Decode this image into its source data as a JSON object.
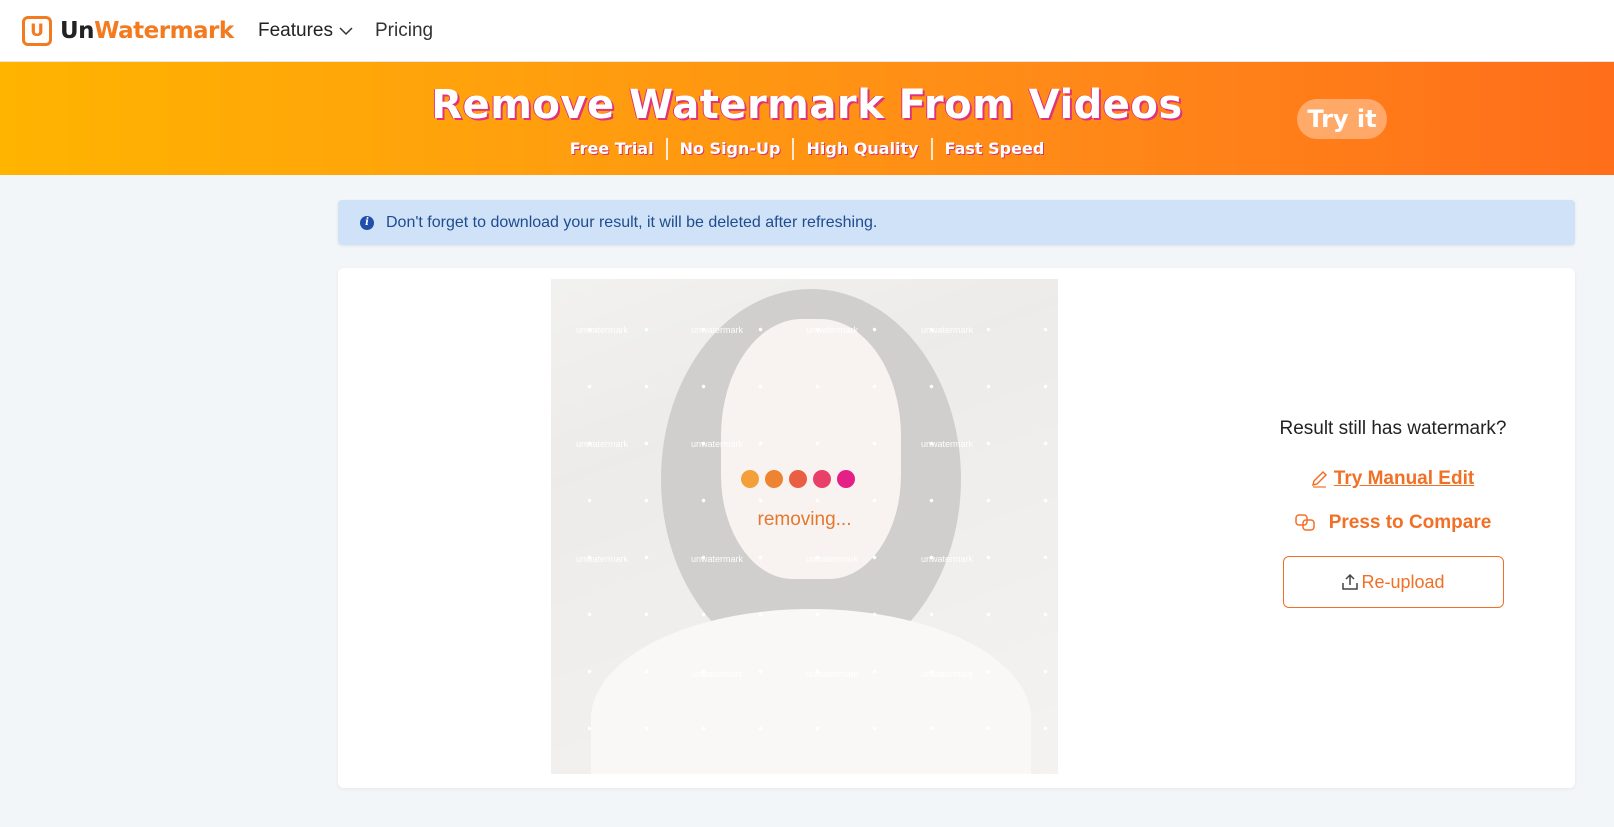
{
  "nav": {
    "logo_un": "Un",
    "logo_wm": "Watermark",
    "logo_mark": "U",
    "features": "Features",
    "pricing": "Pricing"
  },
  "banner": {
    "title": "Remove Watermark From Videos",
    "features": [
      "Free Trial",
      "No Sign-Up",
      "High Quality",
      "Fast Speed"
    ],
    "try_label": "Try it"
  },
  "info": {
    "text": "Don't forget to download your result, it will be deleted after refreshing."
  },
  "preview": {
    "status": "removing...",
    "watermark_text": "unwatermark",
    "dot_colors": [
      "#f4a03a",
      "#ee8431",
      "#ea5f43",
      "#e84069",
      "#e61f86"
    ]
  },
  "side": {
    "question": "Result still has watermark?",
    "manual_edit": "Try Manual Edit",
    "compare": "Press to Compare",
    "reupload": "Re-upload"
  },
  "colors": {
    "accent": "#f07026",
    "info_bg": "#cfe2f8",
    "info_text": "#1f4c8f"
  }
}
